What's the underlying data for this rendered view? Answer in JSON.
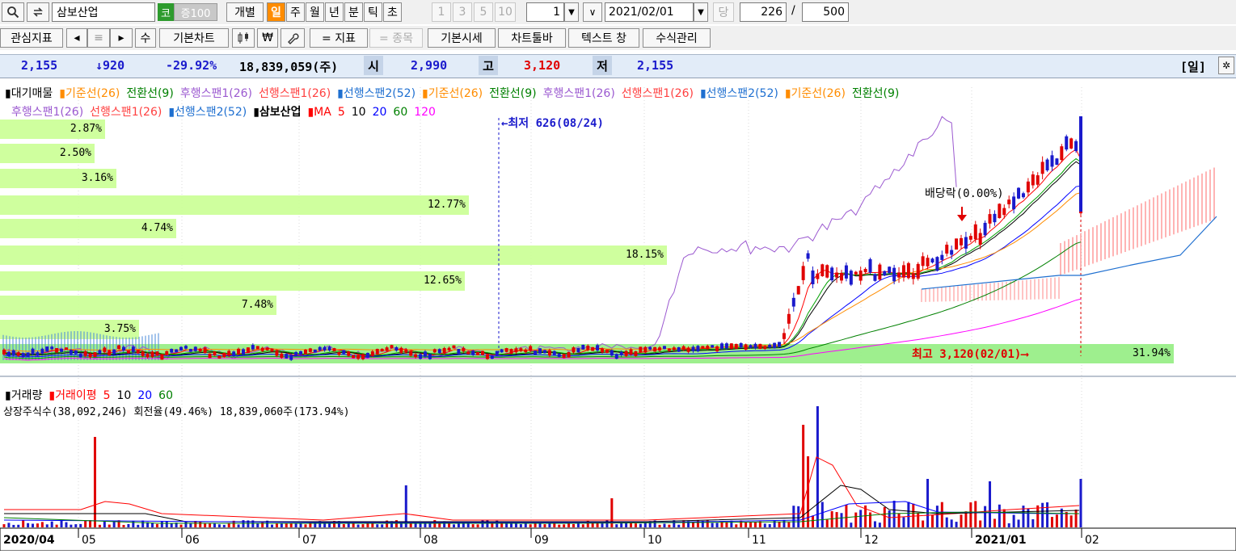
{
  "toolbar1": {
    "search_icon": "magnifier-icon",
    "swap_icon": "swap-icon",
    "stock_name": "삼보산업",
    "market_badge": "코",
    "margin_badge": "증100",
    "mode_individual": "개별",
    "periods": [
      "일",
      "주",
      "월",
      "년",
      "분",
      "틱",
      "초"
    ],
    "active_period": "일",
    "minute_steps": [
      "1",
      "3",
      "5",
      "10"
    ],
    "count_value": "1",
    "date_value": "2021/02/01",
    "today_label": "당",
    "display_count": "226",
    "separator": "/",
    "total_count": "500"
  },
  "toolbar2": {
    "interest_indicator": "관심지표",
    "prev": "◂",
    "menu": "≡",
    "next": "▸",
    "manual": "수",
    "basic_chart": "기본차트",
    "icon_a": "candle-icon",
    "icon_won": "₩",
    "icon_tool": "wrench-icon",
    "indicator_btn": "= 지표",
    "stock_btn": "= 종목",
    "basic_price": "기본시세",
    "chart_toolbar": "차트툴바",
    "text_window": "텍스트 창",
    "formula_mgmt": "수식관리"
  },
  "info_bar": {
    "price": "2,155",
    "change": "↓920",
    "change_pct": "-29.92%",
    "volume": "18,839,059(주)",
    "open_label": "시",
    "open": "2,990",
    "high_label": "고",
    "high": "3,120",
    "low_label": "저",
    "low": "2,155",
    "period_label": "[일]"
  },
  "legend": {
    "row1": [
      {
        "text": "▮대기매물",
        "color": "#000000"
      },
      {
        "text": "▮기준선(26)",
        "color": "#ff8c00"
      },
      {
        "text": "전환선(9)",
        "color": "#008000"
      },
      {
        "text": "후행스팬1(26)",
        "color": "#9b59d0"
      },
      {
        "text": "선행스팬1(26)",
        "color": "#ff4040"
      },
      {
        "text": "▮선행스팬2(52)",
        "color": "#1e6fd0"
      },
      {
        "text": "▮기준선(26)",
        "color": "#ff8c00"
      },
      {
        "text": "전환선(9)",
        "color": "#008000"
      },
      {
        "text": "후행스팬1(26)",
        "color": "#9b59d0"
      },
      {
        "text": "선행스팬1(26)",
        "color": "#ff4040"
      },
      {
        "text": "▮선행스팬2(52)",
        "color": "#1e6fd0"
      },
      {
        "text": "▮기준선(26)",
        "color": "#ff8c00"
      },
      {
        "text": "전환선(9)",
        "color": "#008000"
      }
    ],
    "row2": [
      {
        "text": "후행스팬1(26)",
        "color": "#9b59d0"
      },
      {
        "text": "선행스팬1(26)",
        "color": "#ff4040"
      },
      {
        "text": "▮선행스팬2(52)",
        "color": "#1e6fd0"
      },
      {
        "text": "▮삼보산업",
        "color": "#000000"
      },
      {
        "text": "▮MA",
        "color": "#ff0000"
      },
      {
        "text": "5",
        "color": "#ff0000"
      },
      {
        "text": "10",
        "color": "#000000"
      },
      {
        "text": "20",
        "color": "#0000ff"
      },
      {
        "text": "60",
        "color": "#008000"
      },
      {
        "text": "120",
        "color": "#ff00ff"
      }
    ]
  },
  "volume_profile": [
    "2.87%",
    "2.50%",
    "3.16%",
    "12.77%",
    "4.74%",
    "18.15%",
    "12.65%",
    "7.48%",
    "3.75%",
    "31.94%"
  ],
  "annotations": {
    "lowest": "←최저 626(08/24)",
    "highest": "최고 3,120(02/01)⟶",
    "dividend": "배당락(0.00%)"
  },
  "volume_legend": {
    "items": [
      {
        "text": "▮거래량",
        "color": "#000000"
      },
      {
        "text": "▮거래이평",
        "color": "#ff0000"
      },
      {
        "text": "5",
        "color": "#ff0000"
      },
      {
        "text": "10",
        "color": "#000000"
      },
      {
        "text": "20",
        "color": "#0000ff"
      },
      {
        "text": "60",
        "color": "#008000"
      }
    ],
    "listed_info": "상장주식수(38,092,246) 회전율(49.46%) 18,839,060주(173.94%)"
  },
  "x_axis": [
    "2020/04",
    "05",
    "06",
    "07",
    "08",
    "09",
    "10",
    "11",
    "12",
    "2021/01",
    "02"
  ],
  "colors": {
    "up": "#e00000",
    "down": "#1a1acc",
    "profile": "#ccff99",
    "profile_max": "#99ee88"
  }
}
